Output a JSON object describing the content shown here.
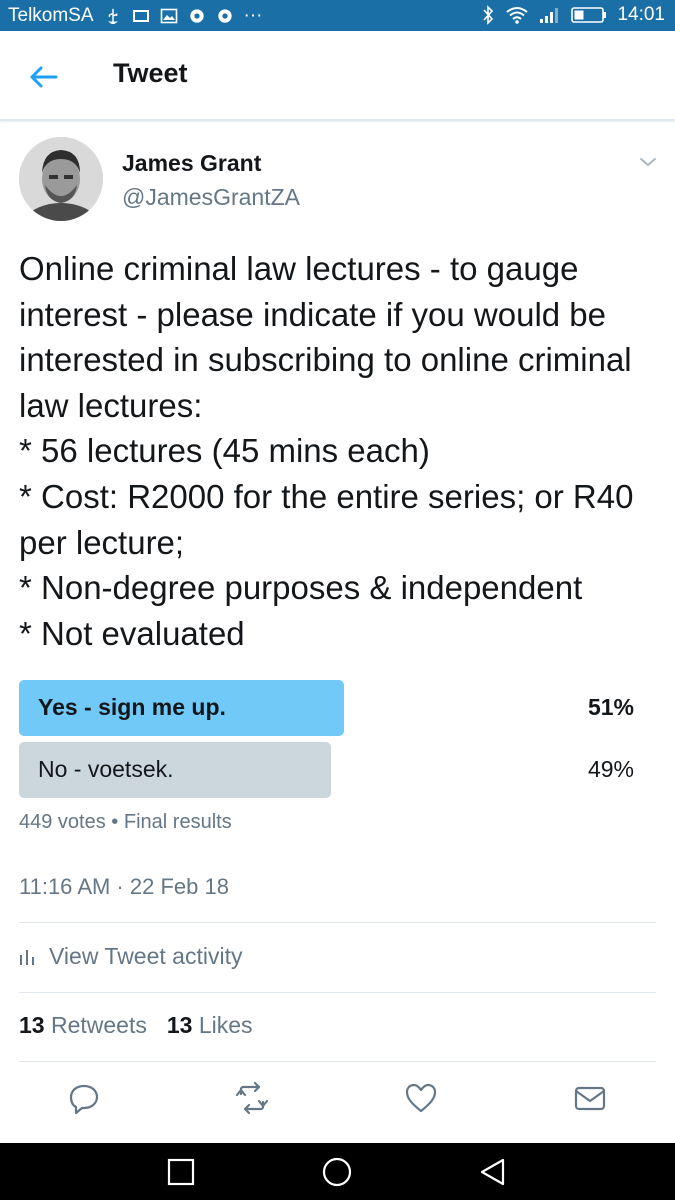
{
  "status_bar": {
    "carrier": "TelkomSA",
    "overflow": "···",
    "time": "14:01"
  },
  "header": {
    "title": "Tweet",
    "back_icon": "arrow-left-icon"
  },
  "tweet": {
    "author_name": "James Grant",
    "author_handle": "@JamesGrantZA",
    "text": "Online criminal law lectures - to gauge interest - please indicate if you would be interested in subscribing to online criminal law lectures:\n* 56 lectures (45 mins each)\n* Cost: R2000 for the entire series; or R40 per lecture;\n* Non-degree purposes & independent\n* Not evaluated",
    "poll": {
      "options": [
        {
          "label": "Yes - sign me up.",
          "percent_label": "51%",
          "percent": 51,
          "winner": true
        },
        {
          "label": "No - voetsek.",
          "percent_label": "49%",
          "percent": 49,
          "winner": false
        }
      ],
      "votes": "449 votes",
      "separator": "•",
      "status": "Final results"
    },
    "timestamp": "11:16 AM · 22 Feb 18",
    "activity_label": "View Tweet activity",
    "retweets_count": "13",
    "retweets_label": "Retweets",
    "likes_count": "13",
    "likes_label": "Likes"
  },
  "colors": {
    "status_bar": "#1a6fa6",
    "accent": "#1da1f2",
    "poll_winner": "#71c9f8",
    "poll_other": "#ccd6dd",
    "secondary_text": "#657786"
  }
}
